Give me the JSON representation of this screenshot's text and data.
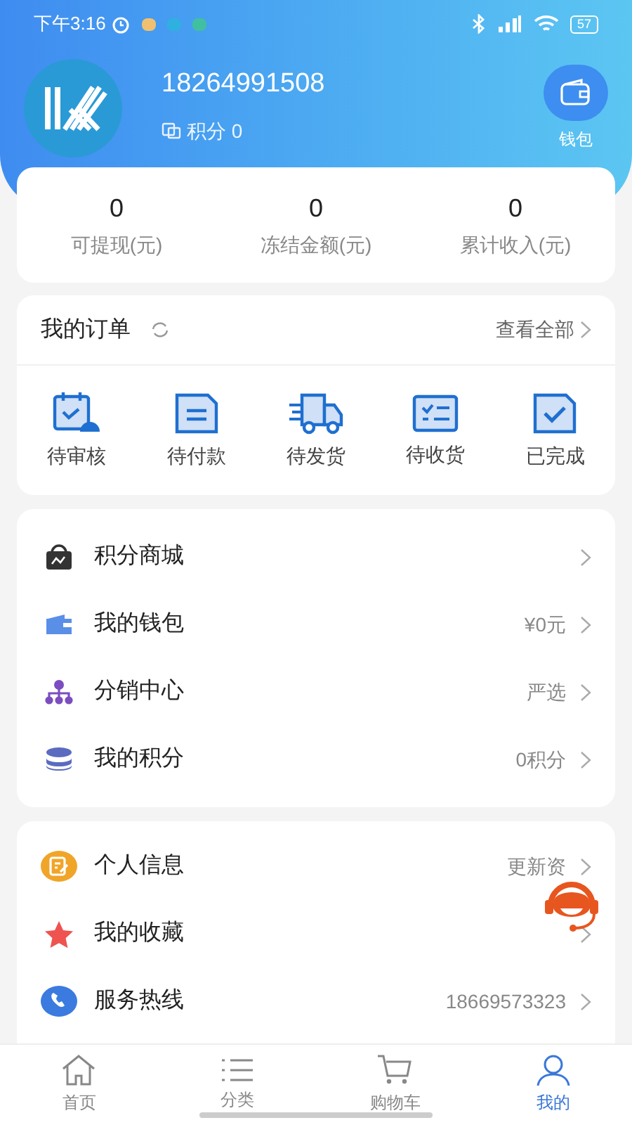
{
  "status_bar": {
    "time": "下午3:16",
    "battery": "57"
  },
  "profile": {
    "phone": "18264991508",
    "points_label": "积分 0",
    "wallet_label": "钱包"
  },
  "stats": [
    {
      "value": "0",
      "label": "可提现(元)"
    },
    {
      "value": "0",
      "label": "冻结金额(元)"
    },
    {
      "value": "0",
      "label": "累计收入(元)"
    }
  ],
  "orders": {
    "title": "我的订单",
    "view_all": "查看全部",
    "statuses": [
      {
        "kind": "review",
        "label": "待审核"
      },
      {
        "kind": "pay",
        "label": "待付款"
      },
      {
        "kind": "ship",
        "label": "待发货"
      },
      {
        "kind": "receive",
        "label": "待收货"
      },
      {
        "kind": "done",
        "label": "已完成"
      }
    ]
  },
  "menu": [
    {
      "kind": "mall",
      "label": "积分商城"
    },
    {
      "kind": "wallet",
      "label": "我的钱包",
      "value": "¥0元"
    },
    {
      "kind": "distribution",
      "label": "分销中心",
      "value": "严选"
    },
    {
      "kind": "points",
      "label": "我的积分",
      "value": "0积分"
    }
  ],
  "service_menu": [
    {
      "kind": "info",
      "label": "个人信息",
      "value": "更新资"
    },
    {
      "kind": "favorite",
      "label": "我的收藏"
    },
    {
      "kind": "hotline",
      "label": "服务热线",
      "value": "18669573323"
    }
  ],
  "tab_bar": [
    {
      "kind": "home",
      "label": "首页",
      "selected": false
    },
    {
      "kind": "category",
      "label": "分类",
      "selected": false
    },
    {
      "kind": "cart",
      "label": "购物车",
      "selected": false
    },
    {
      "kind": "me",
      "label": "我的",
      "selected": true
    }
  ]
}
